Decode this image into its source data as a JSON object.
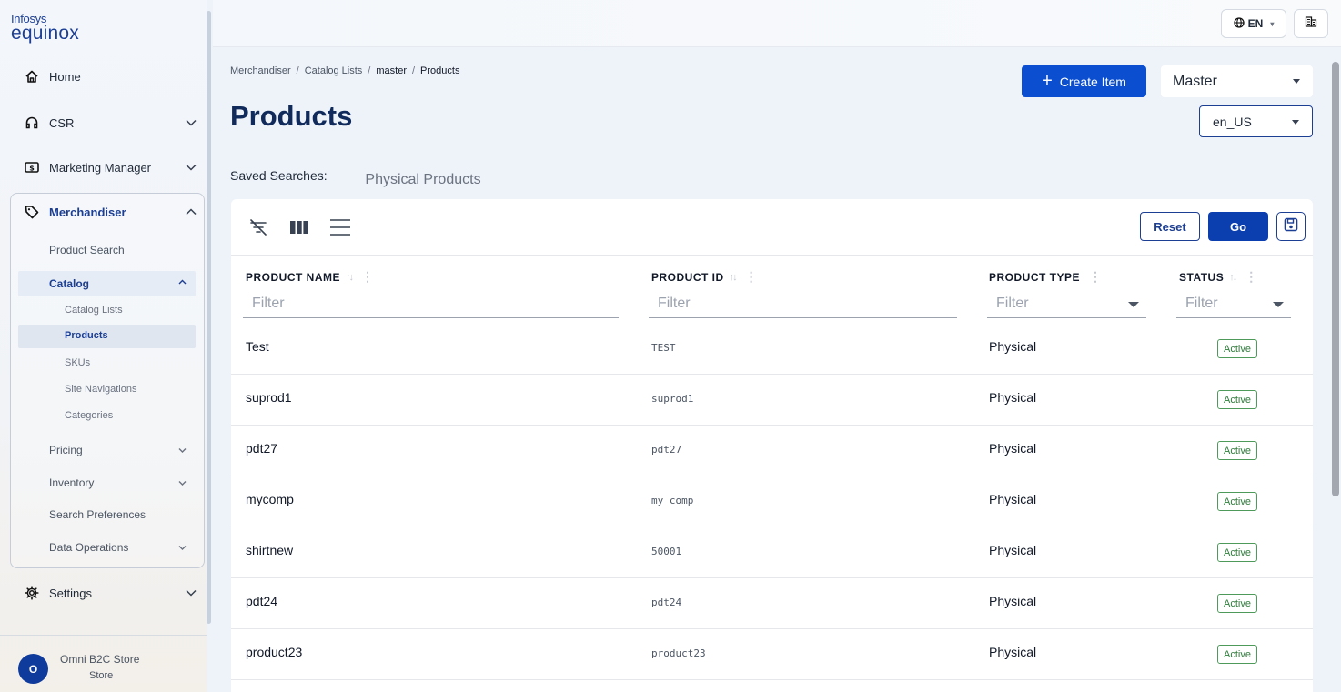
{
  "brand": {
    "line1": "Infosys",
    "line2": "equinox"
  },
  "nav": {
    "home": "Home",
    "csr": "CSR",
    "marketing": "Marketing Manager",
    "merchandiser": "Merchandiser",
    "settings": "Settings",
    "sub": {
      "product_search": "Product Search",
      "catalog": "Catalog",
      "catalog_lists": "Catalog Lists",
      "products": "Products",
      "skus": "SKUs",
      "site_navigations": "Site Navigations",
      "categories": "Categories",
      "pricing": "Pricing",
      "inventory": "Inventory",
      "search_preferences": "Search Preferences",
      "data_operations": "Data Operations"
    }
  },
  "store": {
    "initial": "O",
    "name": "Omni B2C Store",
    "type": "Store"
  },
  "topbar": {
    "language": "EN"
  },
  "breadcrumb": [
    "Merchandiser",
    "Catalog Lists",
    "master",
    "Products"
  ],
  "page": {
    "title": "Products",
    "create_label": "Create Item",
    "catalog": "Master",
    "locale": "en_US"
  },
  "saved_searches": {
    "label": "Saved Searches:",
    "tab": "Physical Products"
  },
  "toolbar": {
    "reset": "Reset",
    "go": "Go"
  },
  "table": {
    "columns": [
      "PRODUCT NAME",
      "PRODUCT ID",
      "PRODUCT TYPE",
      "STATUS"
    ],
    "filter_placeholder": "Filter",
    "rows": [
      {
        "name": "Test",
        "id": "TEST",
        "type": "Physical",
        "status": "Active"
      },
      {
        "name": "suprod1",
        "id": "suprod1",
        "type": "Physical",
        "status": "Active"
      },
      {
        "name": "pdt27",
        "id": "pdt27",
        "type": "Physical",
        "status": "Active"
      },
      {
        "name": "mycomp",
        "id": "my_comp",
        "type": "Physical",
        "status": "Active"
      },
      {
        "name": "shirtnew",
        "id": "50001",
        "type": "Physical",
        "status": "Active"
      },
      {
        "name": "pdt24",
        "id": "pdt24",
        "type": "Physical",
        "status": "Active"
      },
      {
        "name": "product23",
        "id": "product23",
        "type": "Physical",
        "status": "Active"
      }
    ]
  },
  "colors": {
    "primary": "#0b4fd0",
    "navy": "#0f2a5b",
    "brand": "#1c3f94",
    "status": "#2e7d3a"
  }
}
